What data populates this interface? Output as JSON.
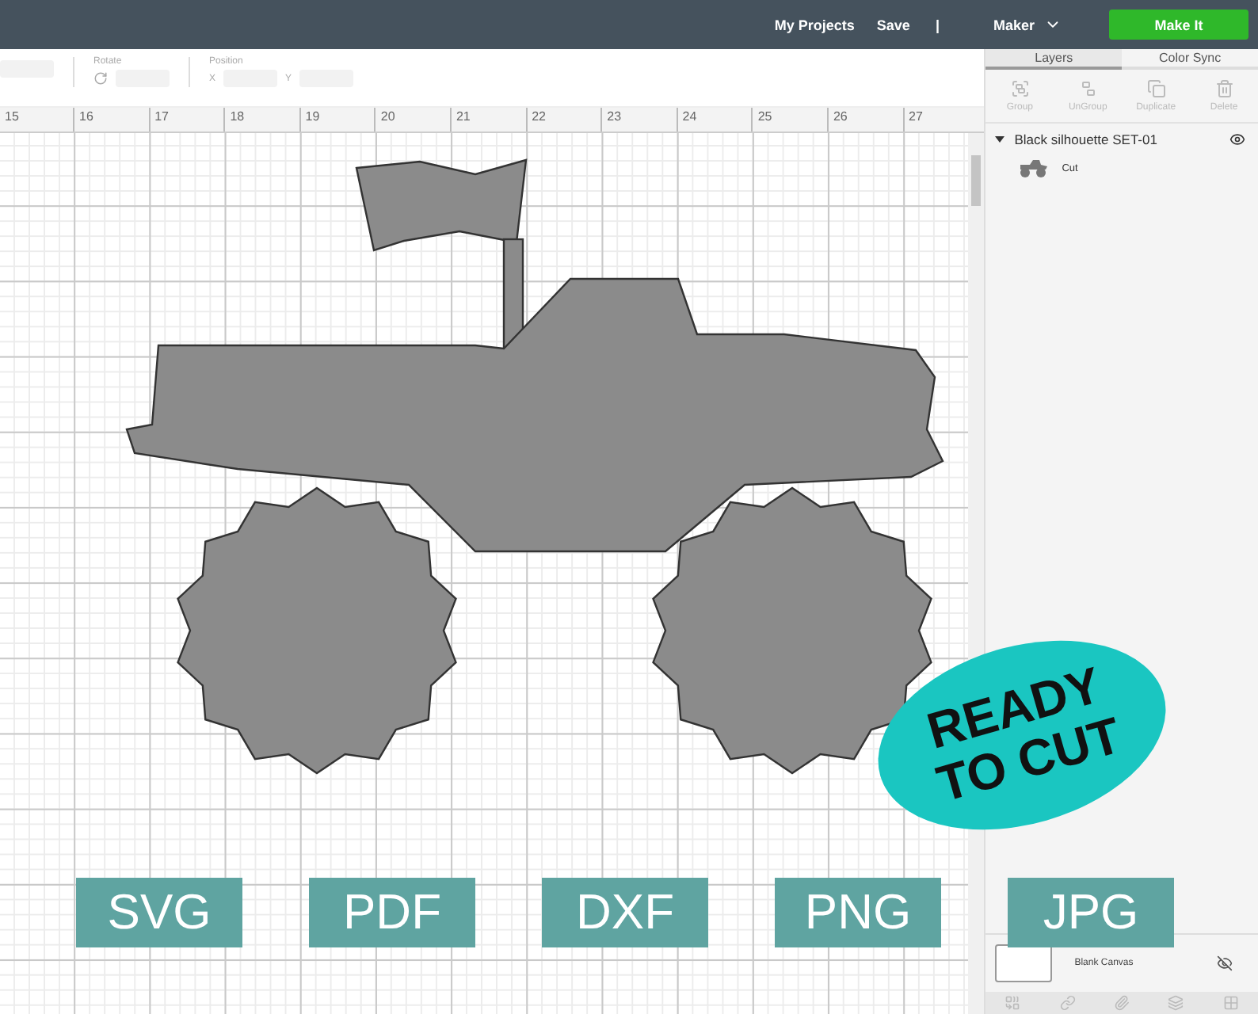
{
  "topbar": {
    "links": [
      "My Projects",
      "Save"
    ],
    "separator": "|",
    "machine": "Maker",
    "make_it": "Make It"
  },
  "edit_toolbar": {
    "rotate": {
      "label": "Rotate"
    },
    "position": {
      "label": "Position",
      "axes": [
        "X",
        "Y"
      ]
    }
  },
  "ruler": [
    "15",
    "16",
    "17",
    "18",
    "19",
    "20",
    "21",
    "22",
    "23",
    "24",
    "25",
    "26",
    "27"
  ],
  "panel": {
    "tabs": [
      {
        "label": "Layers",
        "selected": true
      },
      {
        "label": "Color Sync",
        "selected": false
      }
    ],
    "actions": [
      {
        "label": "Group",
        "disabled": true
      },
      {
        "label": "UnGroup",
        "disabled": true
      },
      {
        "label": "Duplicate",
        "disabled": true
      },
      {
        "label": "Delete",
        "disabled": true
      }
    ],
    "layers": [
      {
        "name": "Black silhouette SET-01",
        "expanded": true,
        "visible": true,
        "children": [
          {
            "name": "Cut"
          }
        ]
      }
    ],
    "blank_canvas": {
      "label": "Blank Canvas",
      "visible": false
    }
  },
  "badge": {
    "lines": [
      "READY",
      "TO CUT"
    ]
  },
  "formats": [
    "SVG",
    "PDF",
    "DXF",
    "PNG",
    "JPG"
  ]
}
